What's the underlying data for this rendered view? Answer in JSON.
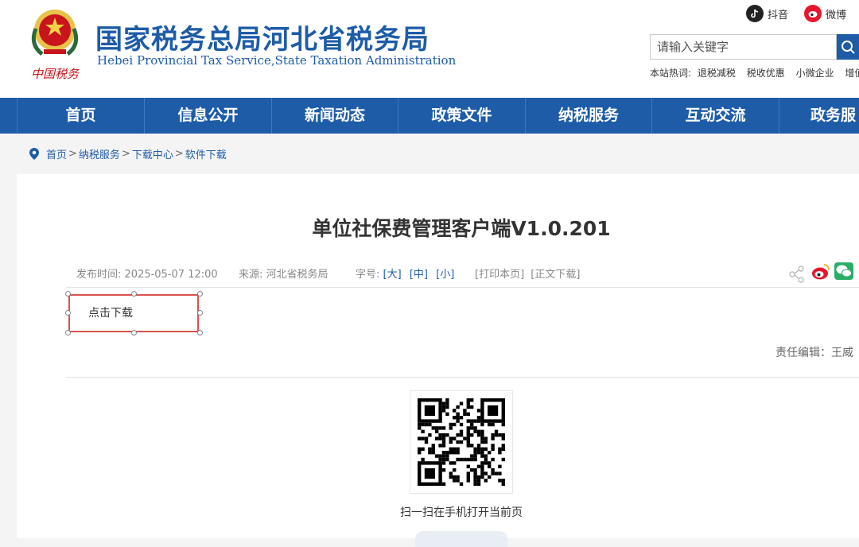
{
  "header": {
    "title": "国家税务总局河北省税务局",
    "subtitle": "Hebei Provincial Tax Service,State Taxation Administration",
    "emblem_text": "中国税务",
    "social": [
      {
        "label": "抖音",
        "icon": "douyin-icon"
      },
      {
        "label": "微博",
        "icon": "weibo-icon"
      }
    ],
    "search": {
      "placeholder": "请输入关键字"
    },
    "hot": {
      "label": "本站热词:",
      "items": [
        "退税减税",
        "税收优惠",
        "小微企业",
        "增值"
      ]
    }
  },
  "nav": {
    "items": [
      "首页",
      "信息公开",
      "新闻动态",
      "政策文件",
      "纳税服务",
      "互动交流",
      "政务服"
    ]
  },
  "breadcrumb": {
    "items": [
      "首页",
      "纳税服务",
      "下载中心",
      "软件下载"
    ],
    "separator": ">"
  },
  "article": {
    "title": "单位社保费管理客户端V1.0.201",
    "publish_label": "发布时间:",
    "publish_time": "2025-05-07 12:00",
    "source_label": "来源:",
    "source": "河北省税务局",
    "font_label": "字号:",
    "font_sizes": [
      "[大]",
      "[中]",
      "[小]"
    ],
    "print": "[打印本页]",
    "download_text": "[正文下载]",
    "download_link": "点击下载",
    "editor": "责任编辑：王威",
    "qr_caption": "扫一扫在手机打开当前页"
  },
  "colors": {
    "brand": "#1e5ca8",
    "highlight": "#d9534f",
    "weibo": "#e6162d",
    "wechat": "#2aae67"
  }
}
